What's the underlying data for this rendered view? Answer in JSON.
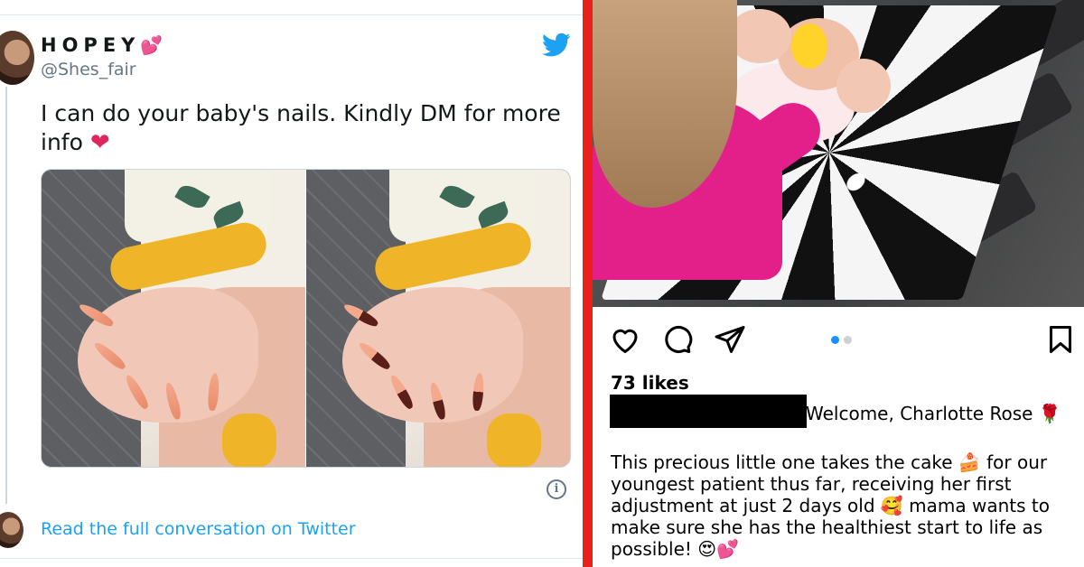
{
  "tweet": {
    "display_name": "HOPEY",
    "name_emoji": "💕",
    "handle": "@Shes_fair",
    "text": "I can do your baby's nails. Kindly DM for more info",
    "text_emoji": "❤",
    "read_more": "Read the full conversation on Twitter",
    "info_glyph": "i",
    "icons": {
      "logo": "twitter-bird-icon",
      "info": "info-icon"
    },
    "colors": {
      "link": "#1da1f2",
      "brand": "#1da1f2",
      "heart": "#e0245e"
    }
  },
  "divider": {
    "color": "#e8221b"
  },
  "instagram": {
    "likes": "73 likes",
    "caption_head": "Welcome, Charlotte Rose",
    "caption_head_emoji": "🌹",
    "caption_body": [
      {
        "text": "This precious little one takes the cake "
      },
      {
        "emoji": "🍰"
      },
      {
        "text": " for our youngest patient thus far, receiving her first adjustment at just 2 days old "
      },
      {
        "emoji": "🥰"
      },
      {
        "text": " mama wants to make sure she has the healthiest start to life as possible! "
      },
      {
        "emoji": "😍"
      },
      {
        "emoji": "💕"
      }
    ],
    "carousel": {
      "total": 2,
      "active": 1
    },
    "icons": [
      "heart-icon",
      "comment-icon",
      "share-icon",
      "bookmark-icon"
    ],
    "colors": {
      "active_dot": "#1a91ff"
    }
  }
}
